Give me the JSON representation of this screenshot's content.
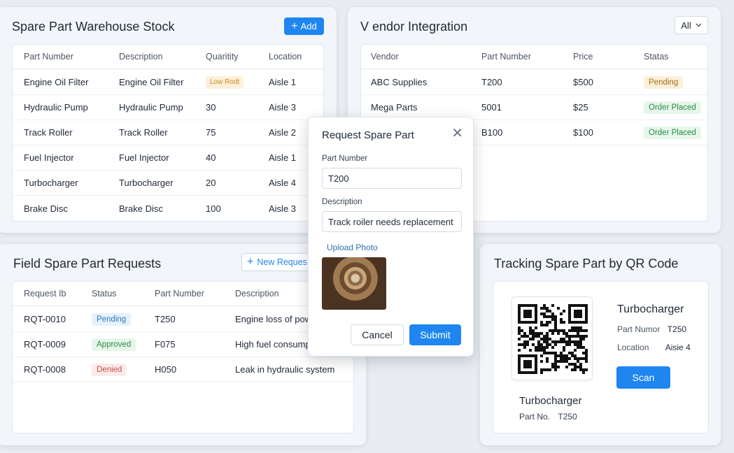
{
  "stock": {
    "title": "Spare Part Warehouse Stock",
    "add_label": "Add",
    "columns": [
      "Part Number",
      "Description",
      "Quaritity",
      "Location"
    ],
    "rows": [
      {
        "part": "Engine Oil Filter",
        "desc": "Engine Oil Filter",
        "qty": "Low Rodt",
        "loc": "Aisle 1"
      },
      {
        "part": "Hydraulic Pump",
        "desc": "Hydraulic Pump",
        "qty": "30",
        "loc": "Aisle 3"
      },
      {
        "part": "Track Roller",
        "desc": "Track Roller",
        "qty": "75",
        "loc": "Aisle 2"
      },
      {
        "part": "Fuel Injector",
        "desc": "Fuel Injector",
        "qty": "40",
        "loc": "Aisle 1"
      },
      {
        "part": "Turbocharger",
        "desc": "Turbocharger",
        "qty": "20",
        "loc": "Aisle 4"
      },
      {
        "part": "Brake Disc",
        "desc": "Brake Disc",
        "qty": "100",
        "loc": "Aisle 3"
      }
    ]
  },
  "vendor": {
    "title": "V endor Integration",
    "filter_value": "All",
    "columns": [
      "Vendor",
      "Part Number",
      "Price",
      "Statas"
    ],
    "rows": [
      {
        "vendor": "ABC Supplies",
        "part": "T200",
        "price": "$500",
        "status": "Pending"
      },
      {
        "vendor": "Mega Parts",
        "part": "5001",
        "price": "$25",
        "status": "Order Placed"
      },
      {
        "vendor": "",
        "part": "B100",
        "price": "$100",
        "status": "Order Placed"
      }
    ]
  },
  "requests": {
    "title": "Field Spare Part Requests",
    "new_label": "New Reques",
    "columns": [
      "Request Ib",
      "Status",
      "Part Number",
      "Description"
    ],
    "rows": [
      {
        "id": "RQT-0010",
        "status": "Pending",
        "part": "T250",
        "desc": "Engine loss of powe"
      },
      {
        "id": "RQT-0009",
        "status": "Approved",
        "part": "F075",
        "desc": "High fuel consumpt"
      },
      {
        "id": "RQT-0008",
        "status": "Denied",
        "part": "H050",
        "desc": "Leak in hydraulic system"
      }
    ]
  },
  "qr": {
    "title": "Tracking Spare Part by QR Code",
    "name": "Turbocharger",
    "part_label": "Part Numor",
    "part_value": "T250",
    "location_label": "Location",
    "location_value": "Aisie 4",
    "scan_label": "Scan",
    "caption_name": "Turbocharger",
    "caption_part_label": "Part No.",
    "caption_part_value": "T250"
  },
  "modal": {
    "title": "Request Spare Part",
    "part_label": "Part Number",
    "part_value": "T200",
    "desc_label": "Description",
    "desc_value": "Track roiler needs replacement",
    "upload_label": "Upload Photo",
    "cancel_label": "Cancel",
    "submit_label": "Submit"
  },
  "icons": {
    "plus": "plus-icon",
    "chevron": "chevron-down-icon",
    "close": "close-icon"
  },
  "colors": {
    "accent": "#1f86f0",
    "background": "#e9edf2"
  }
}
